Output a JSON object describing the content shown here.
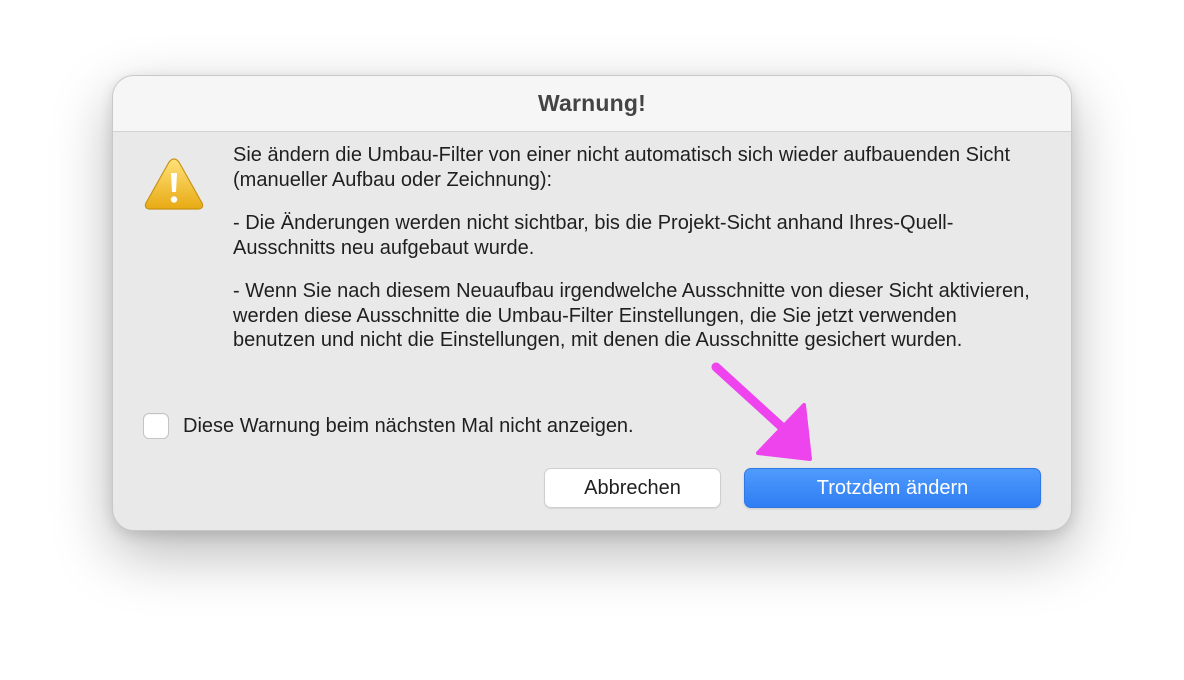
{
  "dialog": {
    "title": "Warnung!",
    "paragraphs": [
      "Sie ändern die Umbau-Filter von einer nicht automatisch sich wieder aufbauenden Sicht (manueller Aufbau oder Zeichnung):",
      "- Die Änderungen werden nicht sichtbar, bis die Projekt-Sicht anhand Ihres-Quell-Ausschnitts neu aufgebaut wurde.",
      "- Wenn Sie nach diesem Neuaufbau irgendwelche Ausschnitte von dieser Sicht aktivieren, werden diese Ausschnitte die Umbau-Filter Einstellungen, die Sie jetzt verwenden benutzen und nicht die Einstellungen, mit denen die Ausschnitte gesichert wurden."
    ],
    "checkbox": {
      "label": "Diese Warnung beim nächsten Mal nicht anzeigen.",
      "checked": false
    },
    "buttons": {
      "cancel_label": "Abbrechen",
      "confirm_label": "Trotzdem ändern"
    },
    "icon": "warning-triangle-icon"
  },
  "annotation": {
    "icon": "arrow-annotation-icon",
    "color": "#ee44ee"
  },
  "colors": {
    "accent": "#3a86f8",
    "warning": "#f2c230",
    "dialog_background": "#e9e9e9",
    "titlebar_background": "#f6f6f6"
  }
}
